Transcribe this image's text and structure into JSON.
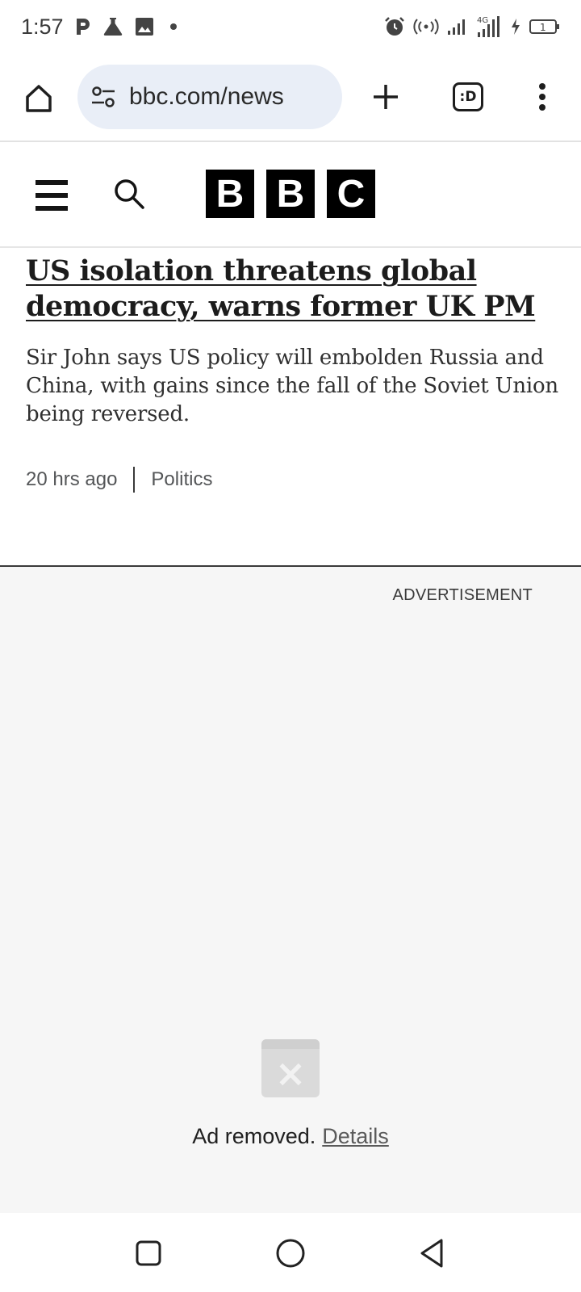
{
  "status_bar": {
    "time": "1:57",
    "left_icons": [
      "parking-icon",
      "flask-icon",
      "image-icon",
      "dot-icon"
    ],
    "right_icons": [
      "alarm-icon",
      "hotspot-icon",
      "signal-icon",
      "signal-4g-icon",
      "charging-icon",
      "battery-icon"
    ],
    "network_label": "4G",
    "battery_level": "1"
  },
  "browser": {
    "url": "bbc.com/news",
    "tabs_label": ":D"
  },
  "site": {
    "logo_letters": [
      "B",
      "B",
      "C"
    ]
  },
  "article": {
    "headline": "US isolation threatens global democracy, warns former UK PM",
    "summary": "Sir John says US policy will embolden Russia and China, with gains since the fall of the Soviet Union being reversed.",
    "time_ago": "20 hrs ago",
    "category": "Politics"
  },
  "ad": {
    "label": "ADVERTISEMENT",
    "removed_text": "Ad removed.",
    "details_link": "Details"
  },
  "nav_bar": {
    "buttons": [
      "recents-icon",
      "home-icon",
      "back-icon"
    ]
  },
  "colors": {
    "url_pill_bg": "#e9eef7",
    "ad_bg": "#f6f6f6",
    "logo_bg": "#000000"
  }
}
